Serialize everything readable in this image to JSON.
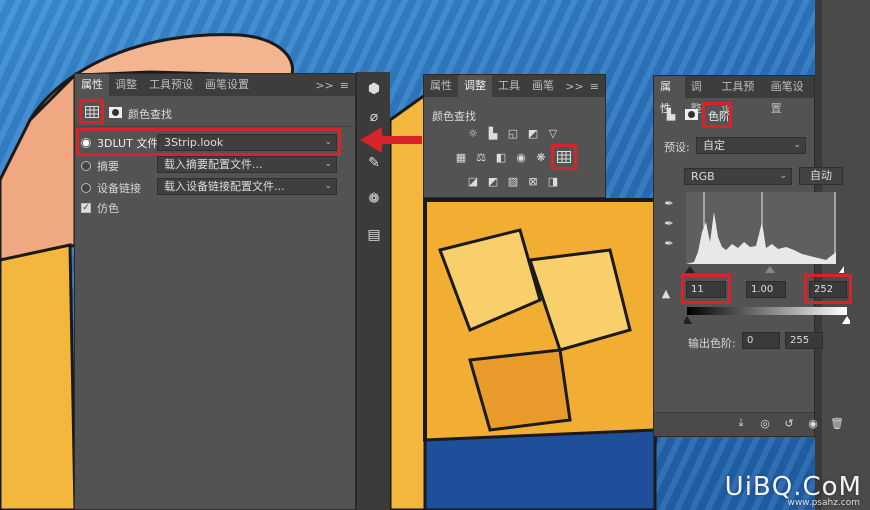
{
  "left_panel": {
    "tabs": [
      "属性",
      "调整",
      "工具预设",
      "画笔设置"
    ],
    "title": "颜色查找",
    "options": [
      {
        "label": "3DLUT 文件",
        "value": "3Strip.look",
        "selected": true
      },
      {
        "label": "摘要",
        "value": "载入摘要配置文件...",
        "selected": false
      },
      {
        "label": "设备链接",
        "value": "载入设备链接配置文件...",
        "selected": false
      }
    ],
    "dither_label": "仿色"
  },
  "mid_panel": {
    "tabs": [
      "属性",
      "调整",
      "工具",
      "画笔"
    ],
    "title": "颜色查找"
  },
  "right_panel": {
    "tabs": [
      "属性",
      "调整",
      "工具预设",
      "画笔设置"
    ],
    "mode_label": "色阶",
    "preset_label": "预设:",
    "preset_value": "自定",
    "channel_value": "RGB",
    "auto_button": "自动",
    "input_black": "11",
    "input_gamma": "1.00",
    "input_white": "252",
    "output_label": "输出色阶:",
    "output_black": "0",
    "output_white": "255"
  },
  "tabbar_controls": {
    "collapse": ">>",
    "menu": "≡"
  },
  "watermark": {
    "main": "UiBQ.CoM",
    "sub": "www.psahz.com"
  },
  "colors": {
    "accent_red": "#d8232a",
    "panel_bg": "#535353",
    "tab_bg": "#3d3d3d"
  }
}
